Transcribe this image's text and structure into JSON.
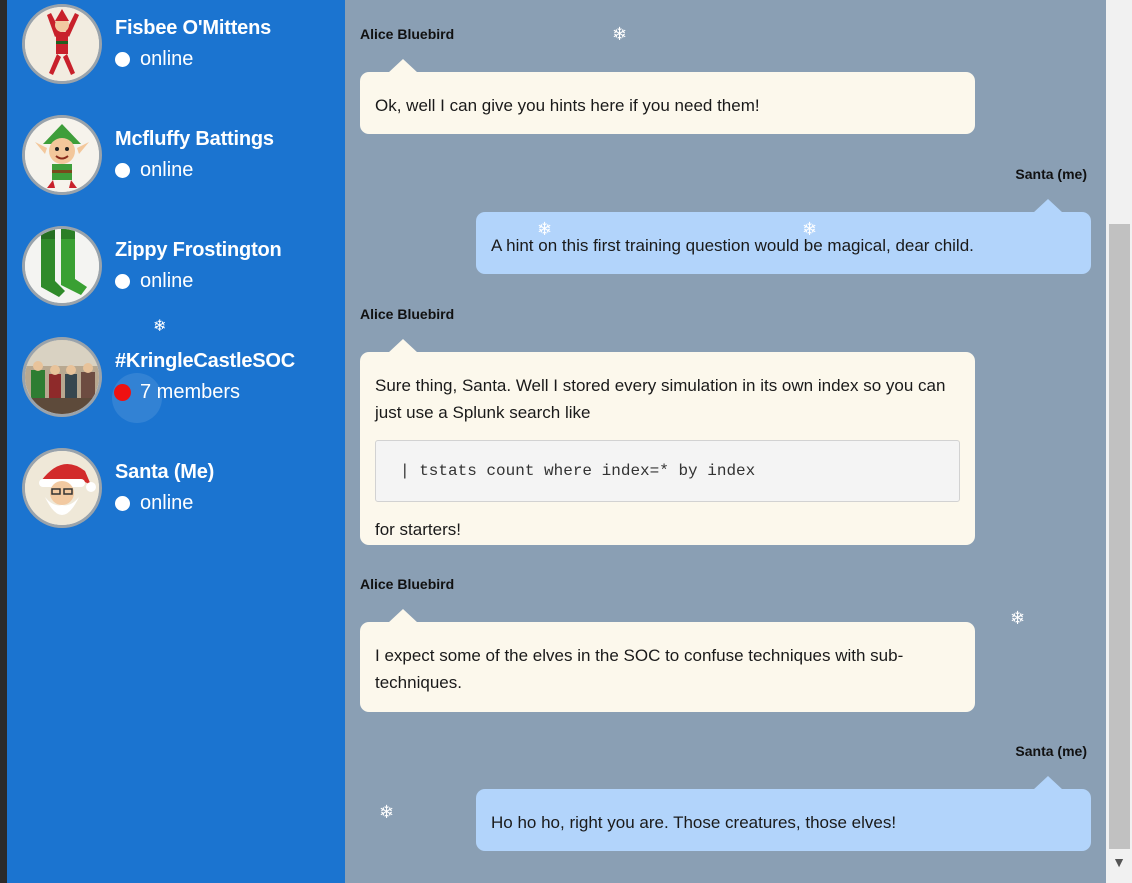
{
  "sidebar": {
    "contacts": [
      {
        "name": "Fisbee O'Mittens",
        "status": "online",
        "avatar_icon": "elf-avatar-icon"
      },
      {
        "name": "Mcfluffy Battings",
        "status": "online",
        "avatar_icon": "elf-avatar-icon"
      },
      {
        "name": "Zippy Frostington",
        "status": "online",
        "avatar_icon": "elf-boots-avatar-icon"
      },
      {
        "name": "#KringleCastleSOC",
        "status": "7 members",
        "avatar_icon": "group-photo-avatar-icon"
      },
      {
        "name": "Santa (Me)",
        "status": "online",
        "avatar_icon": "santa-avatar-icon"
      }
    ]
  },
  "chat": {
    "messages": [
      {
        "sender": "Alice Bluebird",
        "from": "them",
        "text": "Ok, well I can give you hints here if you need them!"
      },
      {
        "sender": "Santa (me)",
        "from": "me",
        "text": "A hint on this first training question would be magical, dear child."
      },
      {
        "sender": "Alice Bluebird",
        "from": "them",
        "text": "Sure thing, Santa. Well I stored every simulation in its own index so you can just use a Splunk search like",
        "code": "| tstats count where index=* by index",
        "after": "for starters!"
      },
      {
        "sender": "Alice Bluebird",
        "from": "them",
        "text": "I expect some of the elves in the SOC to confuse techniques with sub-techniques."
      },
      {
        "sender": "Santa (me)",
        "from": "me",
        "text": "Ho ho ho, right you are. Those creatures, those elves!"
      }
    ]
  },
  "decor": {
    "snowflake": "❄",
    "scroll_down_arrow": "▼"
  },
  "colors": {
    "sidebar_bg": "#1b74d0",
    "chat_bg": "#8a9fb4",
    "their_bubble": "#fcf8ec",
    "my_bubble": "#b2d4fb",
    "group_status_dot": "#ee1111"
  }
}
